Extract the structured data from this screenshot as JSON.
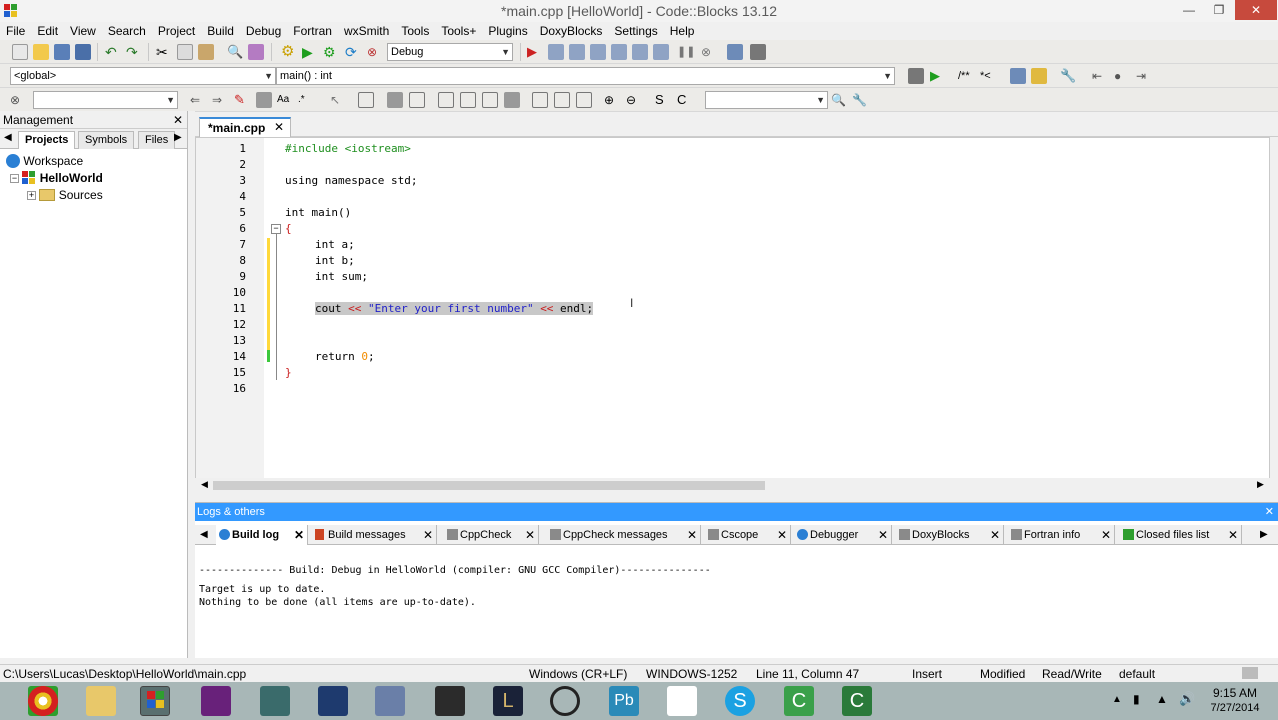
{
  "window": {
    "title": "*main.cpp [HelloWorld] - Code::Blocks 13.12"
  },
  "menu": [
    "File",
    "Edit",
    "View",
    "Search",
    "Project",
    "Build",
    "Debug",
    "Fortran",
    "wxSmith",
    "Tools",
    "Tools+",
    "Plugins",
    "DoxyBlocks",
    "Settings",
    "Help"
  ],
  "toolbar": {
    "build_target": "Debug",
    "scope": "<global>",
    "function": "main() : int"
  },
  "management": {
    "title": "Management",
    "tabs": [
      "Projects",
      "Symbols",
      "Files"
    ],
    "tree": {
      "workspace": "Workspace",
      "project": "HelloWorld",
      "folder": "Sources"
    }
  },
  "editor": {
    "tab_label": "*main.cpp",
    "line_numbers": [
      "1",
      "2",
      "3",
      "4",
      "5",
      "6",
      "7",
      "8",
      "9",
      "10",
      "11",
      "12",
      "13",
      "14",
      "15",
      "16"
    ],
    "lines": {
      "l1_pp": "#include <iostream>",
      "l3_kw": "using namespace",
      "l3_rest": " std;",
      "l5_kw": "int",
      "l5_rest": " main()",
      "l6": "{",
      "l7_kw": "int",
      "l7_rest": " a;",
      "l8_kw": "int",
      "l8_rest": " b;",
      "l9_kw": "int",
      "l9_rest": " sum;",
      "l11_a": "cout ",
      "l11_op1": "<<",
      "l11_str": " \"Enter your first number\" ",
      "l11_op2": "<<",
      "l11_b": " endl;",
      "l14_kw": "return",
      "l14_num": " 0",
      "l14_rest": ";",
      "l15": "}"
    }
  },
  "logs": {
    "title": "Logs & others",
    "tabs": [
      "Build log",
      "Build messages",
      "CppCheck",
      "CppCheck messages",
      "Cscope",
      "Debugger",
      "DoxyBlocks",
      "Fortran info",
      "Closed files list"
    ],
    "lines": [
      "-------------- Build: Debug in HelloWorld (compiler: GNU GCC Compiler)---------------",
      "Target is up to date.",
      "Nothing to be done (all items are up-to-date)."
    ]
  },
  "status": {
    "path": "C:\\Users\\Lucas\\Desktop\\HelloWorld\\main.cpp",
    "eol": "Windows (CR+LF)",
    "encoding": "WINDOWS-1252",
    "position": "Line 11, Column 47",
    "mode": "Insert",
    "modified": "Modified",
    "access": "Read/Write",
    "lang": "default"
  },
  "taskbar": {
    "time": "9:15 AM",
    "date": "7/27/2014"
  }
}
